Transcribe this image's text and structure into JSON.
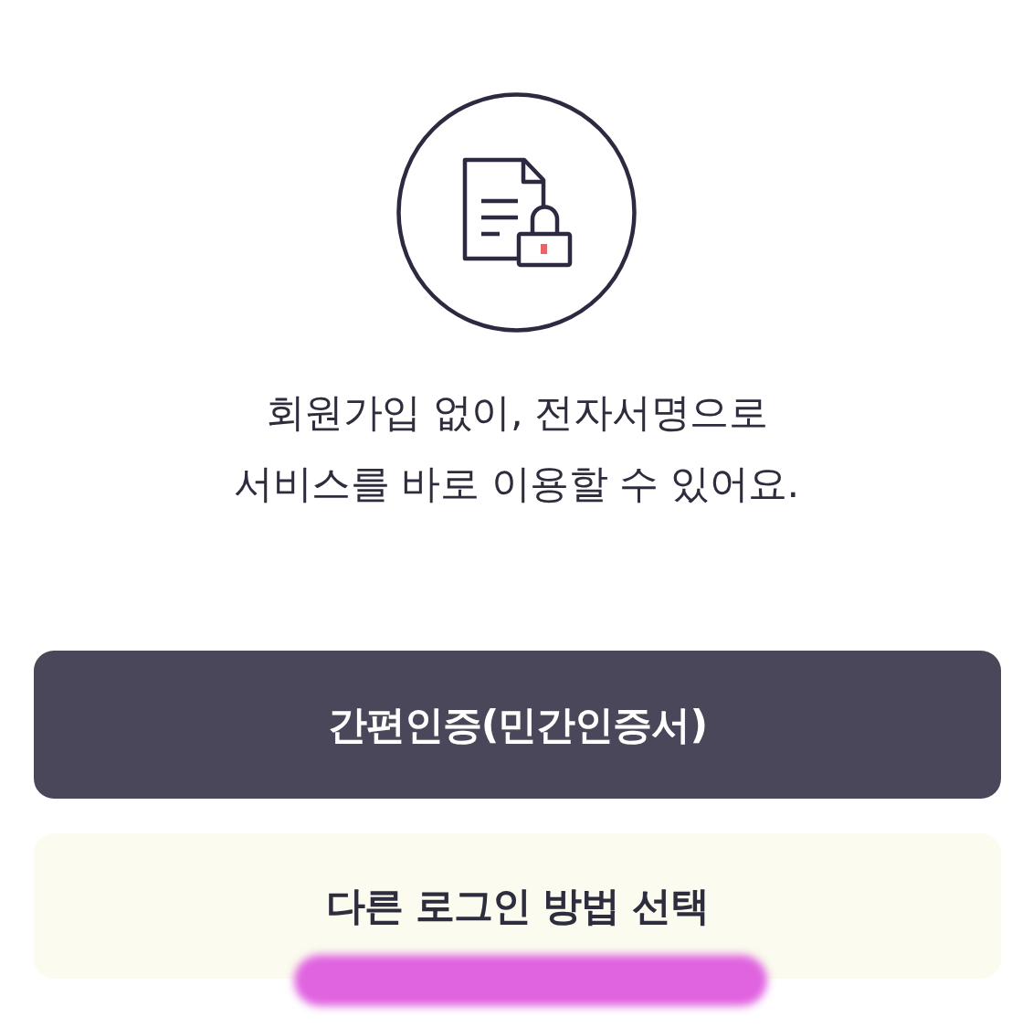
{
  "message": "회원가입 없이, 전자서명으로\n서비스를 바로 이용할 수 있어요.",
  "buttons": [
    {
      "label": "간편인증(민간인증서)",
      "kind": "primary"
    },
    {
      "label": "다른 로그인 방법 선택",
      "kind": "secondary"
    }
  ]
}
